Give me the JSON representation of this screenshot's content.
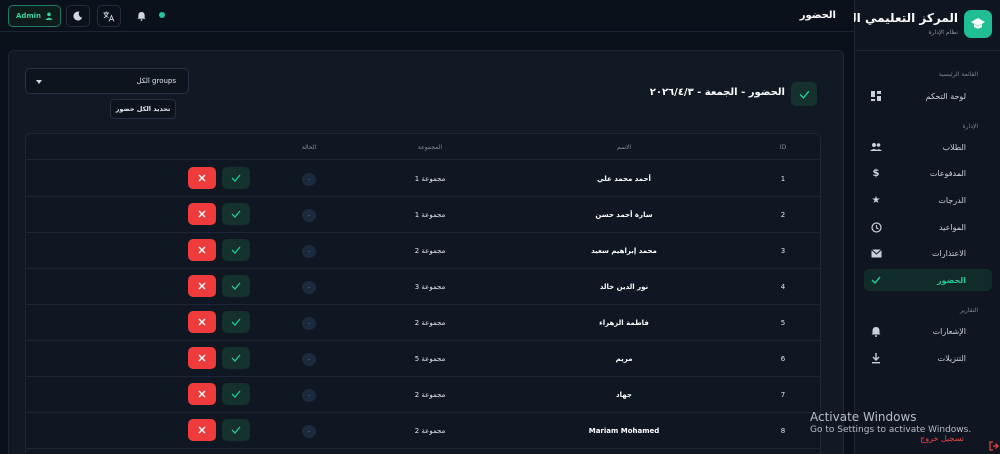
{
  "brand": {
    "title": "المركز التعليمي الذكي",
    "subtitle": "نظام الإدارة"
  },
  "sidebar": {
    "sections": {
      "main": "القائمة الرئيسية",
      "management": "الإدارة",
      "reports": "التقارير"
    },
    "items": [
      {
        "label": "لوحة التحكم",
        "icon": "dashboard-icon"
      },
      {
        "label": "الطلاب",
        "icon": "users-icon"
      },
      {
        "label": "المدفوعات",
        "icon": "dollar-icon"
      },
      {
        "label": "الدرجات",
        "icon": "star-icon"
      },
      {
        "label": "المواعيد",
        "icon": "clock-icon"
      },
      {
        "label": "الاعتذارات",
        "icon": "mail-icon"
      },
      {
        "label": "الحضور",
        "icon": "check-icon",
        "active": true
      },
      {
        "label": "الإشعارات",
        "icon": "bell-icon"
      },
      {
        "label": "التنزيلات",
        "icon": "download-icon"
      }
    ],
    "logout": "تسجيل خروج"
  },
  "header": {
    "title": "الحضور",
    "admin_label": "Admin"
  },
  "attendance": {
    "title": "الحضور - الجمعة - ٢٠٢٦/٤/٣",
    "group_select": "الكل groups",
    "mark_all": "تحديد الكل حضور"
  },
  "table": {
    "columns": {
      "id": "ID",
      "name": "الاسم",
      "group": "المجموعة",
      "status": "الحالة"
    },
    "rows": [
      {
        "id": "1",
        "name": "أحمد محمد علي",
        "group": "مجموعة 1",
        "status": "-"
      },
      {
        "id": "2",
        "name": "سارة أحمد حسن",
        "group": "مجموعة 1",
        "status": "-"
      },
      {
        "id": "3",
        "name": "محمد إبراهيم سعيد",
        "group": "مجموعة 2",
        "status": "-"
      },
      {
        "id": "4",
        "name": "نور الدين خالد",
        "group": "مجموعة 3",
        "status": "-"
      },
      {
        "id": "5",
        "name": "فاطمة الزهراء",
        "group": "مجموعة 2",
        "status": "-"
      },
      {
        "id": "6",
        "name": "مريم",
        "group": "مجموعة 5",
        "status": "-"
      },
      {
        "id": "7",
        "name": "جهاد",
        "group": "مجموعة 2",
        "status": "-"
      },
      {
        "id": "8",
        "name": "Mariam Mohamed",
        "group": "مجموعة 2",
        "status": "-"
      }
    ]
  },
  "watermark": {
    "line1": "Activate Windows",
    "line2": "Go to Settings to activate Windows."
  },
  "colors": {
    "accent": "#22c79a",
    "danger": "#ef3b3b",
    "background": "#0b111a",
    "panel": "#111925"
  }
}
